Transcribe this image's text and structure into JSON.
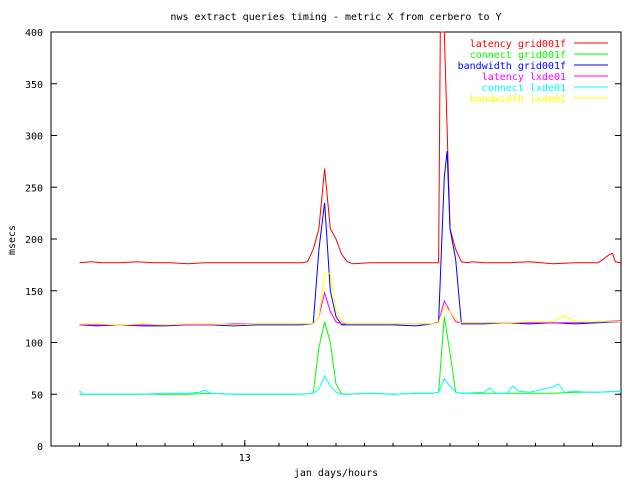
{
  "chart_data": {
    "type": "line",
    "title": "nws extract queries timing - metric X from cerbero to Y",
    "xlabel": "jan days/hours",
    "ylabel": "msecs",
    "ylim": [
      0,
      400
    ],
    "xlim": [
      0,
      100
    ],
    "yticks": [
      0,
      50,
      100,
      150,
      200,
      250,
      300,
      350,
      400
    ],
    "xtick_labels": [
      {
        "x": 34,
        "label": "13"
      }
    ],
    "legend_position": "top-right",
    "grid": false,
    "series": [
      {
        "name": "latency grid001f",
        "color": "#ff0000",
        "x": [
          5,
          7,
          9,
          12,
          15,
          18,
          21,
          24,
          27,
          30,
          33,
          36,
          39,
          42,
          44,
          45,
          46,
          47,
          48,
          49,
          50,
          51,
          52,
          53,
          56,
          60,
          64,
          67,
          68,
          68.3,
          69,
          70,
          71,
          72,
          73,
          74,
          76,
          80,
          84,
          88,
          92,
          96,
          98,
          98.5,
          99,
          100
        ],
        "y": [
          177,
          178,
          177,
          177,
          178,
          177,
          177,
          176,
          177,
          177,
          177,
          177,
          177,
          177,
          177,
          178,
          190,
          210,
          268,
          210,
          200,
          185,
          178,
          176,
          177,
          177,
          177,
          177,
          177,
          400,
          400,
          210,
          190,
          178,
          177,
          178,
          177,
          177,
          178,
          176,
          177,
          177,
          185,
          186,
          178,
          177
        ]
      },
      {
        "name": "connect grid001f",
        "color": "#00ff00",
        "x": [
          5,
          8,
          12,
          16,
          20,
          24,
          28,
          32,
          36,
          40,
          44,
          46,
          47,
          48,
          49,
          50,
          51,
          52,
          56,
          60,
          64,
          67,
          68,
          69,
          70,
          71,
          72,
          76,
          80,
          84,
          88,
          92,
          96,
          100
        ],
        "y": [
          50,
          50,
          50,
          50,
          50,
          50,
          51,
          50,
          50,
          50,
          50,
          51,
          95,
          120,
          100,
          60,
          50,
          50,
          51,
          50,
          51,
          51,
          52,
          125,
          90,
          52,
          51,
          51,
          51,
          51,
          51,
          52,
          52,
          53
        ]
      },
      {
        "name": "bandwidth grid001f",
        "color": "#0000ff",
        "x": [
          5,
          8,
          12,
          16,
          20,
          24,
          28,
          32,
          36,
          40,
          44,
          46,
          47,
          48,
          49,
          50,
          51,
          52,
          56,
          60,
          64,
          67,
          68,
          69,
          69.5,
          70,
          71,
          72,
          76,
          80,
          84,
          88,
          92,
          96,
          100
        ],
        "y": [
          117,
          116,
          117,
          116,
          116,
          117,
          117,
          116,
          117,
          117,
          117,
          118,
          190,
          235,
          150,
          125,
          117,
          117,
          117,
          117,
          116,
          118,
          120,
          260,
          285,
          210,
          180,
          118,
          118,
          119,
          118,
          119,
          118,
          119,
          120
        ]
      },
      {
        "name": "latency lxde01",
        "color": "#ff00ff",
        "x": [
          5,
          8,
          12,
          16,
          20,
          24,
          28,
          32,
          36,
          40,
          44,
          46,
          47,
          48,
          49,
          50,
          51,
          52,
          56,
          60,
          64,
          67,
          68,
          69,
          70,
          71,
          72,
          76,
          80,
          84,
          88,
          92,
          96,
          100
        ],
        "y": [
          117,
          117,
          117,
          117,
          117,
          117,
          117,
          118,
          118,
          118,
          118,
          118,
          125,
          148,
          130,
          120,
          118,
          118,
          118,
          118,
          118,
          118,
          120,
          140,
          130,
          120,
          119,
          119,
          119,
          119,
          119,
          119,
          120,
          121
        ]
      },
      {
        "name": "connect lxde01",
        "color": "#00ffff",
        "x": [
          5,
          5.5,
          6,
          8,
          12,
          16,
          20,
          24,
          26,
          27,
          28,
          32,
          36,
          40,
          44,
          46,
          47,
          48,
          49,
          50,
          51,
          52,
          56,
          60,
          64,
          67,
          68,
          69,
          70,
          71,
          72,
          76,
          77,
          78,
          80,
          81,
          82,
          84,
          88,
          89,
          90,
          92,
          94,
          96,
          100
        ],
        "y": [
          54,
          50,
          50,
          50,
          50,
          50,
          51,
          51,
          52,
          54,
          51,
          50,
          50,
          50,
          50,
          51,
          55,
          68,
          58,
          52,
          50,
          50,
          51,
          50,
          51,
          51,
          52,
          65,
          58,
          52,
          51,
          52,
          56,
          51,
          51,
          58,
          53,
          52,
          57,
          60,
          52,
          53,
          52,
          52,
          53
        ]
      },
      {
        "name": "bandwidth lxde01",
        "color": "#ffff00",
        "x": [
          5,
          8,
          12,
          16,
          20,
          24,
          28,
          32,
          36,
          40,
          44,
          46,
          47,
          48,
          49,
          50,
          51,
          52,
          56,
          60,
          64,
          67,
          68,
          69,
          70,
          71,
          72,
          76,
          80,
          84,
          88,
          90,
          92,
          96,
          100
        ],
        "y": [
          118,
          118,
          117,
          118,
          117,
          118,
          118,
          117,
          118,
          118,
          118,
          118,
          125,
          167,
          167,
          130,
          120,
          118,
          118,
          118,
          118,
          118,
          119,
          135,
          130,
          122,
          119,
          119,
          119,
          120,
          120,
          126,
          120,
          120,
          120
        ]
      }
    ]
  }
}
